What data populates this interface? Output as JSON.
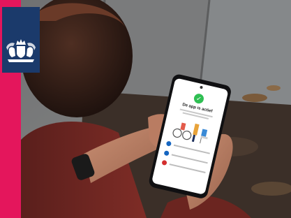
{
  "brand": {
    "logo": "dutch-royal-coat-of-arms-logo",
    "colors": {
      "ribbon": "#e4165c",
      "logo_background": "#1b3a6b"
    }
  },
  "phone_screen": {
    "status_icon": "check-circle-icon",
    "title": "De app is actief",
    "list_icons": [
      "info-icon",
      "info-icon",
      "warning-icon"
    ],
    "colors": {
      "active": "#2fbf53",
      "info": "#1565c0",
      "warning": "#d32f2f"
    }
  }
}
